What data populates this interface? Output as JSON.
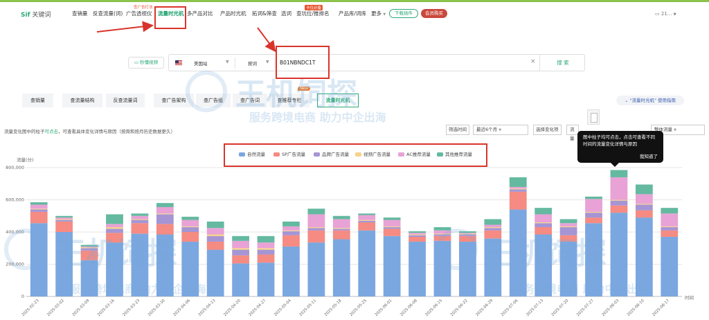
{
  "topnav": {
    "logo_brand": "Sif",
    "logo_name": "关键词",
    "items": [
      {
        "label": "查销量"
      },
      {
        "label": "反查流量(词)"
      },
      {
        "label": "广告透视仪",
        "tag": "查广告打法"
      },
      {
        "label": "流量时光机"
      },
      {
        "label": "多产品对比"
      },
      {
        "label": "产品时光机"
      },
      {
        "label": "拓词&筛查"
      },
      {
        "label": "选词"
      },
      {
        "label": "查坑位/推排名",
        "tag": "卡位必备"
      },
      {
        "label": "产品库/词库"
      },
      {
        "label": "更多"
      }
    ],
    "plugin_btn": "下载插件",
    "buy_btn": "会员购买",
    "user": "21..."
  },
  "search": {
    "quick_btn": "秒懂视频",
    "site": "美国站",
    "mode": "按词",
    "value": "B01NBNDC1T",
    "submit": "搜 索"
  },
  "tabs": [
    {
      "label": "查销量"
    },
    {
      "label": "查流量结构"
    },
    {
      "label": "反查流量词"
    },
    {
      "label": "查广告架构"
    },
    {
      "label": "查广告组"
    },
    {
      "label": "查广告词"
    },
    {
      "label": "查推荐专栏",
      "tag": "New"
    },
    {
      "label": "流量时光机"
    }
  ],
  "guide": "\"流量时光机\" 使用指南",
  "hint": {
    "prefix": "流量变化图中的柱子",
    "link": "可点击",
    "suffix": "，可查看具体变化详情与原因（按周和按月历史数据更久）"
  },
  "filters": {
    "period_label": "筛选时间",
    "period_value": "最近6个月",
    "change_label": "选择变化项",
    "change_value": "流量",
    "extra_value": "整体流量"
  },
  "tooltip": {
    "text": "图中柱子均可点击，点击可查看不同时间的流量变化详情与原因",
    "ok": "我知道了"
  },
  "watermark": {
    "brand": "王机饲探",
    "slogan": "服务跨境电商 助力中企出海"
  },
  "chart_data": {
    "type": "bar",
    "stacked": true,
    "ylabel": "流量(分)",
    "xlabel": "时间",
    "ylim": [
      0,
      800000
    ],
    "yticks": [
      "0",
      "200,000",
      "400,000",
      "600,000",
      "800,000"
    ],
    "grid": true,
    "legend_position": "top-center",
    "categories": [
      "2025-02-23",
      "2025-03-02",
      "2025-03-09",
      "2025-03-16",
      "2025-03-23",
      "2025-03-30",
      "2025-04-06",
      "2025-04-13",
      "2025-04-20",
      "2025-04-27",
      "2025-05-04",
      "2025-05-11",
      "2025-05-18",
      "2025-05-25",
      "2025-06-01",
      "2025-06-08",
      "2025-06-15",
      "2025-06-22",
      "2025-06-29",
      "2025-07-06",
      "2025-07-13",
      "2025-07-20",
      "2025-07-27",
      "2025-08-03",
      "2025-08-10",
      "2025-08-17"
    ],
    "series": [
      {
        "name": "自然流量",
        "color": "#7ba7e0",
        "values": [
          455000,
          400000,
          225000,
          335000,
          390000,
          385000,
          340000,
          290000,
          205000,
          210000,
          310000,
          335000,
          355000,
          410000,
          375000,
          340000,
          345000,
          340000,
          360000,
          540000,
          385000,
          340000,
          455000,
          520000,
          490000,
          370000
        ]
      },
      {
        "name": "SP广告流量",
        "color": "#f58b82",
        "values": [
          70000,
          65000,
          60000,
          60000,
          65000,
          65000,
          60000,
          50000,
          50000,
          50000,
          70000,
          75000,
          55000,
          50000,
          45000,
          30000,
          30000,
          35000,
          50000,
          110000,
          45000,
          40000,
          35000,
          45000,
          45000,
          40000
        ]
      },
      {
        "name": "品牌广告流量",
        "color": "#a595d4",
        "values": [
          15000,
          10000,
          15000,
          25000,
          20000,
          60000,
          30000,
          35000,
          35000,
          30000,
          25000,
          15000,
          10000,
          10000,
          10000,
          10000,
          10000,
          10000,
          15000,
          15000,
          25000,
          50000,
          30000,
          30000,
          35000,
          20000
        ]
      },
      {
        "name": "视频广告流量",
        "color": "#f6d28a",
        "values": [
          5000,
          5000,
          5000,
          10000,
          5000,
          5000,
          5000,
          10000,
          10000,
          10000,
          5000,
          5000,
          5000,
          5000,
          5000,
          5000,
          5000,
          5000,
          5000,
          5000,
          5000,
          5000,
          5000,
          5000,
          5000,
          5000
        ]
      },
      {
        "name": "AC推荐流量",
        "color": "#e8a2d6",
        "values": [
          25000,
          10000,
          5000,
          20000,
          20000,
          40000,
          40000,
          40000,
          45000,
          35000,
          25000,
          80000,
          55000,
          30000,
          40000,
          10000,
          20000,
          5000,
          15000,
          10000,
          50000,
          20000,
          80000,
          140000,
          60000,
          80000
        ]
      },
      {
        "name": "其他推荐流量",
        "color": "#64b9a0",
        "values": [
          15000,
          10000,
          10000,
          60000,
          15000,
          25000,
          20000,
          40000,
          30000,
          40000,
          30000,
          35000,
          20000,
          10000,
          15000,
          10000,
          20000,
          10000,
          35000,
          60000,
          40000,
          25000,
          15000,
          45000,
          60000,
          35000
        ]
      }
    ]
  }
}
